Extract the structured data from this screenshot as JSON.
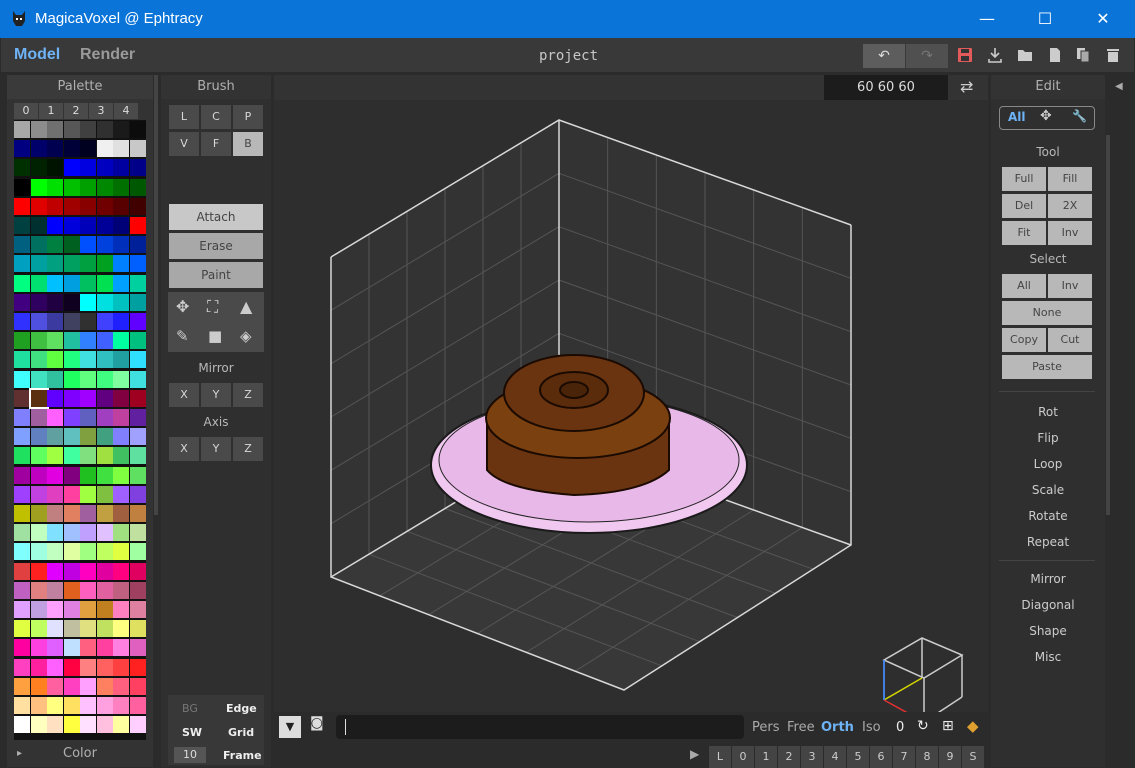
{
  "window": {
    "title": "MagicaVoxel @ Ephtracy",
    "minimize": "—",
    "maximize": "☐",
    "close": "✕"
  },
  "topbar": {
    "mode_model": "Model",
    "mode_render": "Render",
    "project": "project",
    "undo": "↶",
    "redo": "↷",
    "icons": [
      "save-icon",
      "download-icon",
      "folder-icon",
      "file-icon",
      "copy-icon",
      "trash-icon"
    ]
  },
  "palette": {
    "title": "Palette",
    "tabs": [
      "0",
      "1",
      "2",
      "3",
      "4"
    ],
    "rows": [
      [
        "#a8a8a8",
        "#8c8c8c",
        "#707070",
        "#575757",
        "#404040",
        "#303030",
        "#1a1a1a",
        "#0c0c0c"
      ],
      [
        "#000080",
        "#00006a",
        "#000050",
        "#000038",
        "#000020",
        "#f0f0f0",
        "#e0e0e0",
        "#c8c8c8"
      ],
      [
        "#003000",
        "#002200",
        "#001200",
        "#0000ff",
        "#0000e0",
        "#0000c0",
        "#0000a0",
        "#000088"
      ],
      [
        "#000000",
        "#00ff00",
        "#00e000",
        "#00c000",
        "#00a000",
        "#008800",
        "#007000",
        "#005800"
      ],
      [
        "#ff0000",
        "#e00000",
        "#c00000",
        "#a00000",
        "#880000",
        "#700000",
        "#580000",
        "#400000"
      ],
      [
        "#004040",
        "#003030",
        "#0000ff",
        "#0000dd",
        "#0000bb",
        "#000099",
        "#000077",
        "#ff0000"
      ],
      [
        "#006080",
        "#007060",
        "#008040",
        "#006020",
        "#0050ff",
        "#0040dd",
        "#0030bb",
        "#002099"
      ],
      [
        "#00a0c0",
        "#00a0a0",
        "#00a080",
        "#00a060",
        "#00a040",
        "#00a020",
        "#0080ff",
        "#0060ff"
      ],
      [
        "#00ff80",
        "#00e070",
        "#00c0ff",
        "#00a0e0",
        "#00c060",
        "#00e050",
        "#00a0ff",
        "#00d0a0"
      ],
      [
        "#400080",
        "#300060",
        "#200040",
        "#100020",
        "#00ffff",
        "#00e0e0",
        "#00c0c0",
        "#00a0a0"
      ],
      [
        "#3030ff",
        "#5050e0",
        "#3a3aa0",
        "#404060",
        "#303030",
        "#4040ff",
        "#2020ff",
        "#6000ff"
      ],
      [
        "#20a020",
        "#40c040",
        "#60e060",
        "#20c0a0",
        "#3080ff",
        "#4060ff",
        "#00ffa0",
        "#00c080"
      ],
      [
        "#20e0a0",
        "#40e080",
        "#60ff40",
        "#20ff80",
        "#40e0e0",
        "#30c0c0",
        "#20a0a0",
        "#30e0ff"
      ],
      [
        "#40ffff",
        "#40e0c0",
        "#30c0a0",
        "#20ff60",
        "#60ff80",
        "#40ff80",
        "#80ffa0",
        "#40e0e0"
      ],
      [
        "#603030",
        "#703010",
        "#6000ff",
        "#8000ff",
        "#a000ff",
        "#600080",
        "#800040",
        "#a00020"
      ],
      [
        "#8080ff",
        "#a060a0",
        "#ff60ff",
        "#8040ff",
        "#6060c0",
        "#a040c0",
        "#c040a0",
        "#6020a0"
      ],
      [
        "#80a0ff",
        "#6080c0",
        "#60a0a0",
        "#60c0c0",
        "#80a040",
        "#40a080",
        "#8080ff",
        "#a0a0ff"
      ],
      [
        "#20e060",
        "#60ff60",
        "#a0ff40",
        "#40ffa0",
        "#80e080",
        "#a0e040",
        "#40c060",
        "#60e0a0"
      ],
      [
        "#a000a0",
        "#c000c0",
        "#e000e0",
        "#800080",
        "#20c020",
        "#40e040",
        "#80ff40",
        "#60e060"
      ],
      [
        "#a040ff",
        "#c040e0",
        "#e040c0",
        "#ff40a0",
        "#a0ff40",
        "#80c040",
        "#a060ff",
        "#8040e0"
      ],
      [
        "#c0c000",
        "#a0a020",
        "#c08080",
        "#e08060",
        "#a060a0",
        "#c0a040",
        "#a06040",
        "#c08040"
      ],
      [
        "#a0e0a0",
        "#c0ffc0",
        "#80e0ff",
        "#a0c0ff",
        "#c0a0ff",
        "#e0c0ff",
        "#a0e080",
        "#c0e0a0"
      ],
      [
        "#80ffff",
        "#a0ffe0",
        "#c0ffc0",
        "#e0ffa0",
        "#a0ff80",
        "#c0ff60",
        "#e0ff40",
        "#a0ffa0"
      ],
      [
        "#e04040",
        "#ff2020",
        "#e000ff",
        "#c000e0",
        "#ff00c0",
        "#e000a0",
        "#ff0080",
        "#e00060"
      ],
      [
        "#c060c0",
        "#e08080",
        "#c080a0",
        "#e06020",
        "#ff60c0",
        "#e060a0",
        "#c06080",
        "#a04060"
      ],
      [
        "#e0a0ff",
        "#c0a0e0",
        "#ffa0ff",
        "#e080e0",
        "#e0a040",
        "#c08020",
        "#ff80c0",
        "#e080a0"
      ],
      [
        "#e0ff40",
        "#c0ff60",
        "#e0e0ff",
        "#c0c0a0",
        "#e0e080",
        "#c0e060",
        "#ffff80",
        "#e0e060"
      ],
      [
        "#ff00a0",
        "#ff40e0",
        "#e060ff",
        "#c0e0ff",
        "#ff6080",
        "#ff40a0",
        "#ff80e0",
        "#e060c0"
      ],
      [
        "#ff40c0",
        "#ff20a0",
        "#ff60ff",
        "#ff0040",
        "#ff8080",
        "#ff6060",
        "#ff4040",
        "#ff2020"
      ],
      [
        "#ffa040",
        "#ff8020",
        "#ff60a0",
        "#ff40c0",
        "#ffa0ff",
        "#ff8060",
        "#ff6080",
        "#ff4060"
      ],
      [
        "#ffe0a0",
        "#ffc080",
        "#ffff80",
        "#ffe060",
        "#ffc0ff",
        "#ffa0e0",
        "#ff80c0",
        "#ff60a0"
      ],
      [
        "#ffffff",
        "#ffffc0",
        "#ffe0c0",
        "#ffff40",
        "#ffe0ff",
        "#ffc0e0",
        "#ffffa0",
        "#ffd0ff"
      ]
    ],
    "footer": "Color",
    "expand": "▸"
  },
  "brush": {
    "title": "Brush",
    "row1": [
      "L",
      "C",
      "P"
    ],
    "row2": [
      "V",
      "F",
      "B"
    ],
    "modes": [
      "Attach",
      "Erase",
      "Paint"
    ],
    "mirror_title": "Mirror",
    "mirror": [
      "X",
      "Y",
      "Z"
    ],
    "axis_title": "Axis",
    "axis": [
      "X",
      "Y",
      "Z"
    ],
    "bottom": {
      "bg": "BG",
      "edge": "Edge",
      "sw": "SW",
      "grid": "Grid",
      "frame_num": "10",
      "frame": "Frame"
    }
  },
  "viewport": {
    "dims": "60  60  60",
    "swap": "⇄",
    "bottom": {
      "play": "▼",
      "camera": "📷",
      "views": [
        "Pers",
        "Free",
        "Orth",
        "Iso"
      ],
      "angle": "0",
      "frames": [
        "L",
        "0",
        "1",
        "2",
        "3",
        "4",
        "5",
        "6",
        "7",
        "8",
        "9",
        "S"
      ]
    }
  },
  "edit": {
    "title": "Edit",
    "tabs": [
      "All",
      "✥",
      "🔧"
    ],
    "tool_title": "Tool",
    "tool": [
      [
        "Full",
        "Fill"
      ],
      [
        "Del",
        "2X"
      ],
      [
        "Fit",
        "Inv"
      ]
    ],
    "select_title": "Select",
    "select": [
      [
        "All",
        "Inv"
      ]
    ],
    "none": "None",
    "copycut": [
      "Copy",
      "Cut"
    ],
    "paste": "Paste",
    "ops1": [
      "Rot",
      "Flip",
      "Loop",
      "Scale",
      "Rotate",
      "Repeat"
    ],
    "ops2": [
      "Mirror",
      "Diagonal",
      "Shape",
      "Misc"
    ]
  }
}
